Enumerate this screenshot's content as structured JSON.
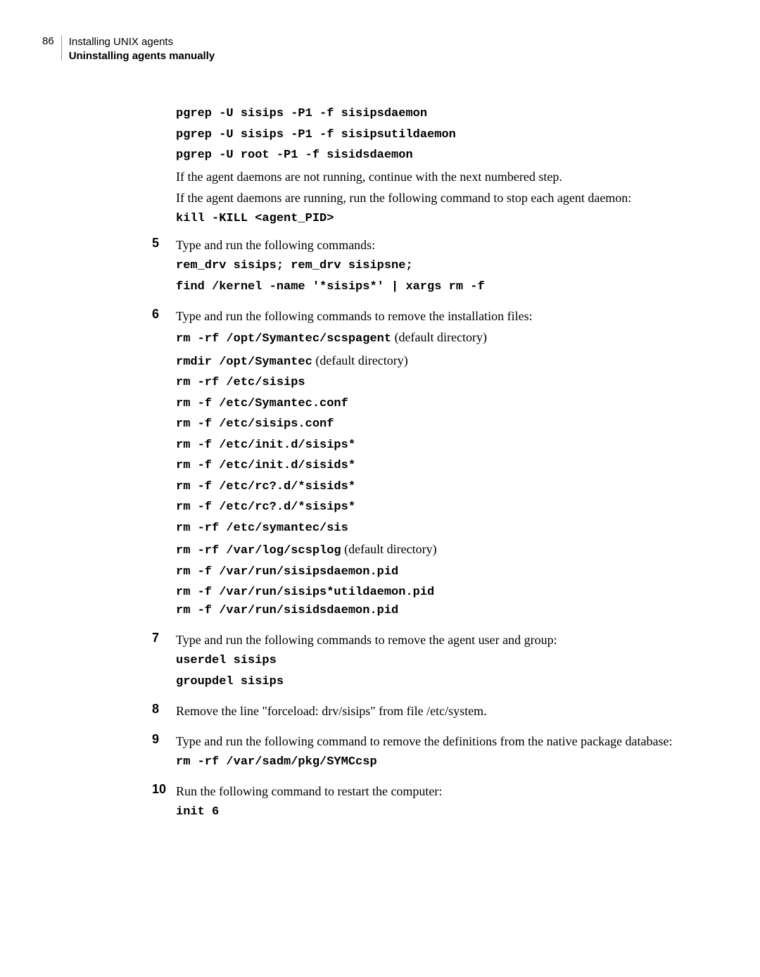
{
  "header": {
    "page_number": "86",
    "title": "Installing UNIX agents",
    "subtitle": "Uninstalling agents manually"
  },
  "intro": {
    "cmd1": "pgrep -U sisips -P1 -f sisipsdaemon",
    "cmd2": "pgrep -U sisips -P1 -f sisipsutildaemon",
    "cmd3": "pgrep -U root -P1 -f sisidsdaemon",
    "text1": "If the agent daemons are not running, continue with the next numbered step.",
    "text2": "If the agent daemons are running, run the following command to stop each agent daemon:",
    "cmd4": "kill -KILL <agent_PID>"
  },
  "step5": {
    "num": "5",
    "text": "Type and run the following commands:",
    "cmd1": "rem_drv sisips; rem_drv sisipsne;",
    "cmd2": "find /kernel -name '*sisips*' | xargs rm -f"
  },
  "step6": {
    "num": "6",
    "text": "Type and run the following commands to remove the installation files:",
    "c1a": "rm -rf /opt/Symantec/scspagent",
    "c1b": " (default directory)",
    "c2a": "rmdir /opt/Symantec",
    "c2b": " (default directory)",
    "c3": "rm -rf /etc/sisips",
    "c4": "rm -f /etc/Symantec.conf",
    "c5": "rm -f /etc/sisips.conf",
    "c6": "rm -f /etc/init.d/sisips*",
    "c7": "rm -f /etc/init.d/sisids*",
    "c8": "rm -f /etc/rc?.d/*sisids*",
    "c9": "rm -f /etc/rc?.d/*sisips*",
    "c10": "rm -rf /etc/symantec/sis",
    "c11a": "rm -rf /var/log/scsplog",
    "c11b": " (default directory)",
    "c12": "rm -f /var/run/sisipsdaemon.pid",
    "c13": "rm -f /var/run/sisips*utildaemon.pid",
    "c14": "rm -f /var/run/sisidsdaemon.pid"
  },
  "step7": {
    "num": "7",
    "text": "Type and run the following commands to remove the agent user and group:",
    "cmd1": "userdel sisips",
    "cmd2": "groupdel sisips"
  },
  "step8": {
    "num": "8",
    "text": "Remove the line \"forceload: drv/sisips\" from file /etc/system."
  },
  "step9": {
    "num": "9",
    "text": "Type and run the following command to remove the definitions from the native package database:",
    "cmd1": "rm -rf /var/sadm/pkg/SYMCcsp"
  },
  "step10": {
    "num": "10",
    "text": "Run the following command to restart the computer:",
    "cmd1": "init 6"
  }
}
